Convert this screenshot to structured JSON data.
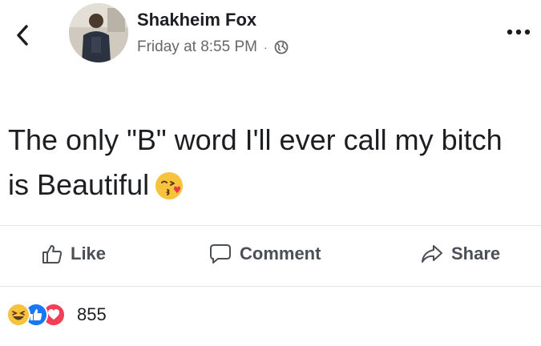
{
  "post": {
    "author": "Shakheim Fox",
    "timestamp": "Friday at 8:55 PM",
    "separator": "·",
    "privacy_icon": "globe-icon",
    "text": "The only \"B\" word I'll ever call my bitch is Beautiful",
    "emoji": "kissing-heart-emoji"
  },
  "actions": {
    "like_label": "Like",
    "comment_label": "Comment",
    "share_label": "Share"
  },
  "reactions": {
    "types": [
      "haha",
      "like",
      "love"
    ],
    "count": "855"
  },
  "colors": {
    "facebook_blue": "#1877f2",
    "love_red": "#f33e58",
    "haha_yellow": "#f7c23c",
    "meta_gray": "#65676b",
    "action_gray": "#4b4f56"
  }
}
